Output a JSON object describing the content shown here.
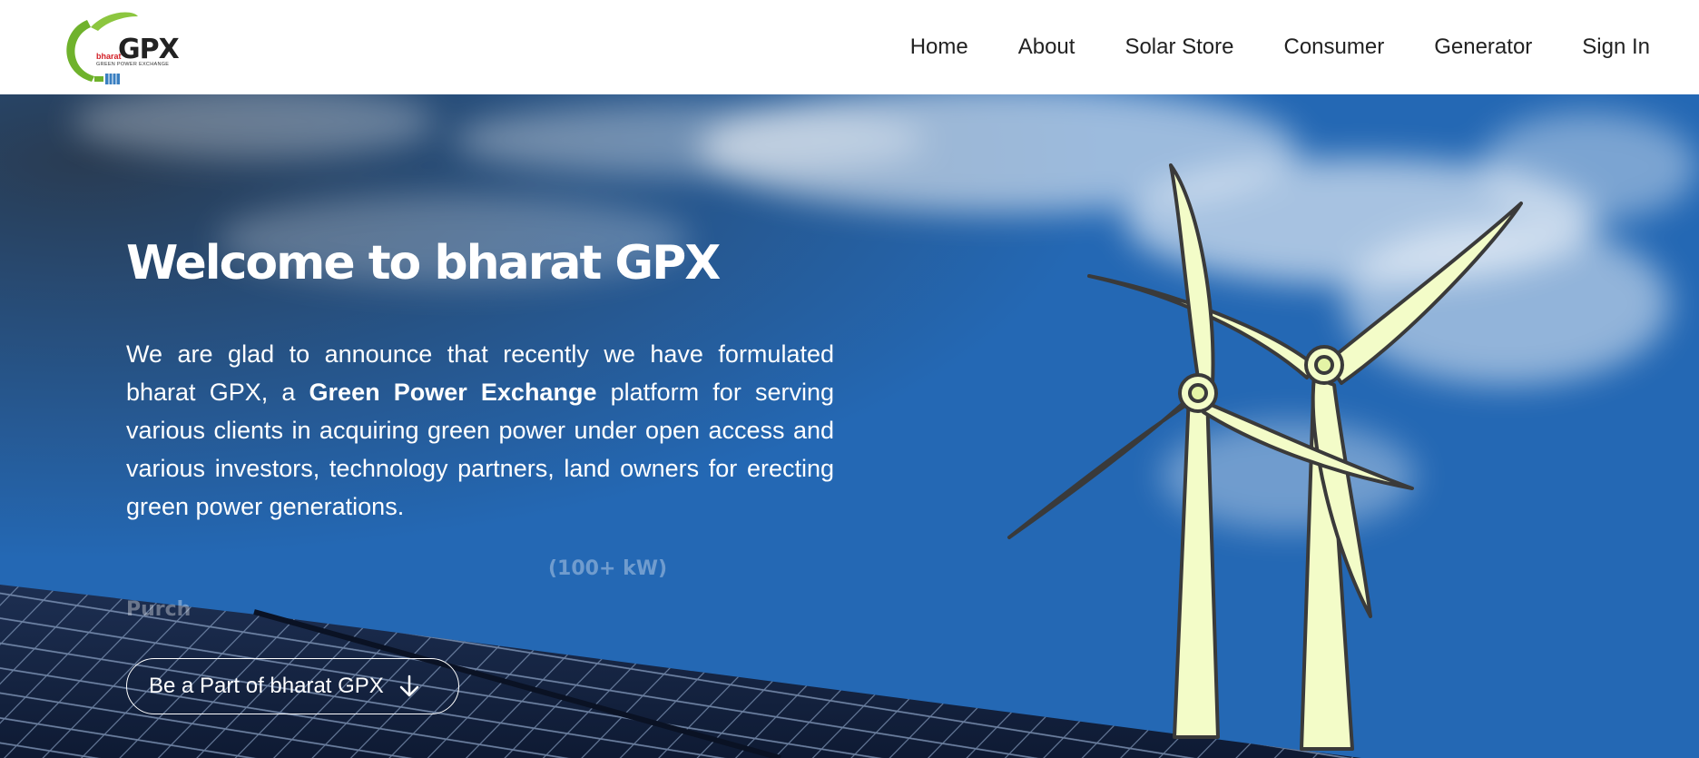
{
  "logo": {
    "wordmark": "GPX",
    "prefix": "bharat",
    "tagline": "GREEN POWER EXCHANGE"
  },
  "nav": {
    "items": [
      {
        "label": "Home"
      },
      {
        "label": "About"
      },
      {
        "label": "Solar Store"
      },
      {
        "label": "Consumer"
      },
      {
        "label": "Generator"
      },
      {
        "label": "Sign In"
      }
    ]
  },
  "hero": {
    "title": "Welcome to bharat GPX",
    "desc_part1": "We are glad to announce that recently we have formulated bharat GPX, a ",
    "desc_bold": "Green Power Exchange",
    "desc_part2": " platform for serving various clients in acquiring green power under open access and various investors, technology partners, land owners for erecting green power generations.",
    "ghost_line1": "(100+ kW)",
    "ghost_line2": "Purch",
    "cta_label": "Be a Part of bharat GPX"
  },
  "colors": {
    "sky_blue": "#2368b6",
    "turbine_fill": "#f3fcc8",
    "turbine_stroke": "#3a3a3a",
    "logo_green": "#6fb22c",
    "logo_red": "#d21f26"
  },
  "icons": {
    "cta_icon": "arrow-down-icon"
  }
}
